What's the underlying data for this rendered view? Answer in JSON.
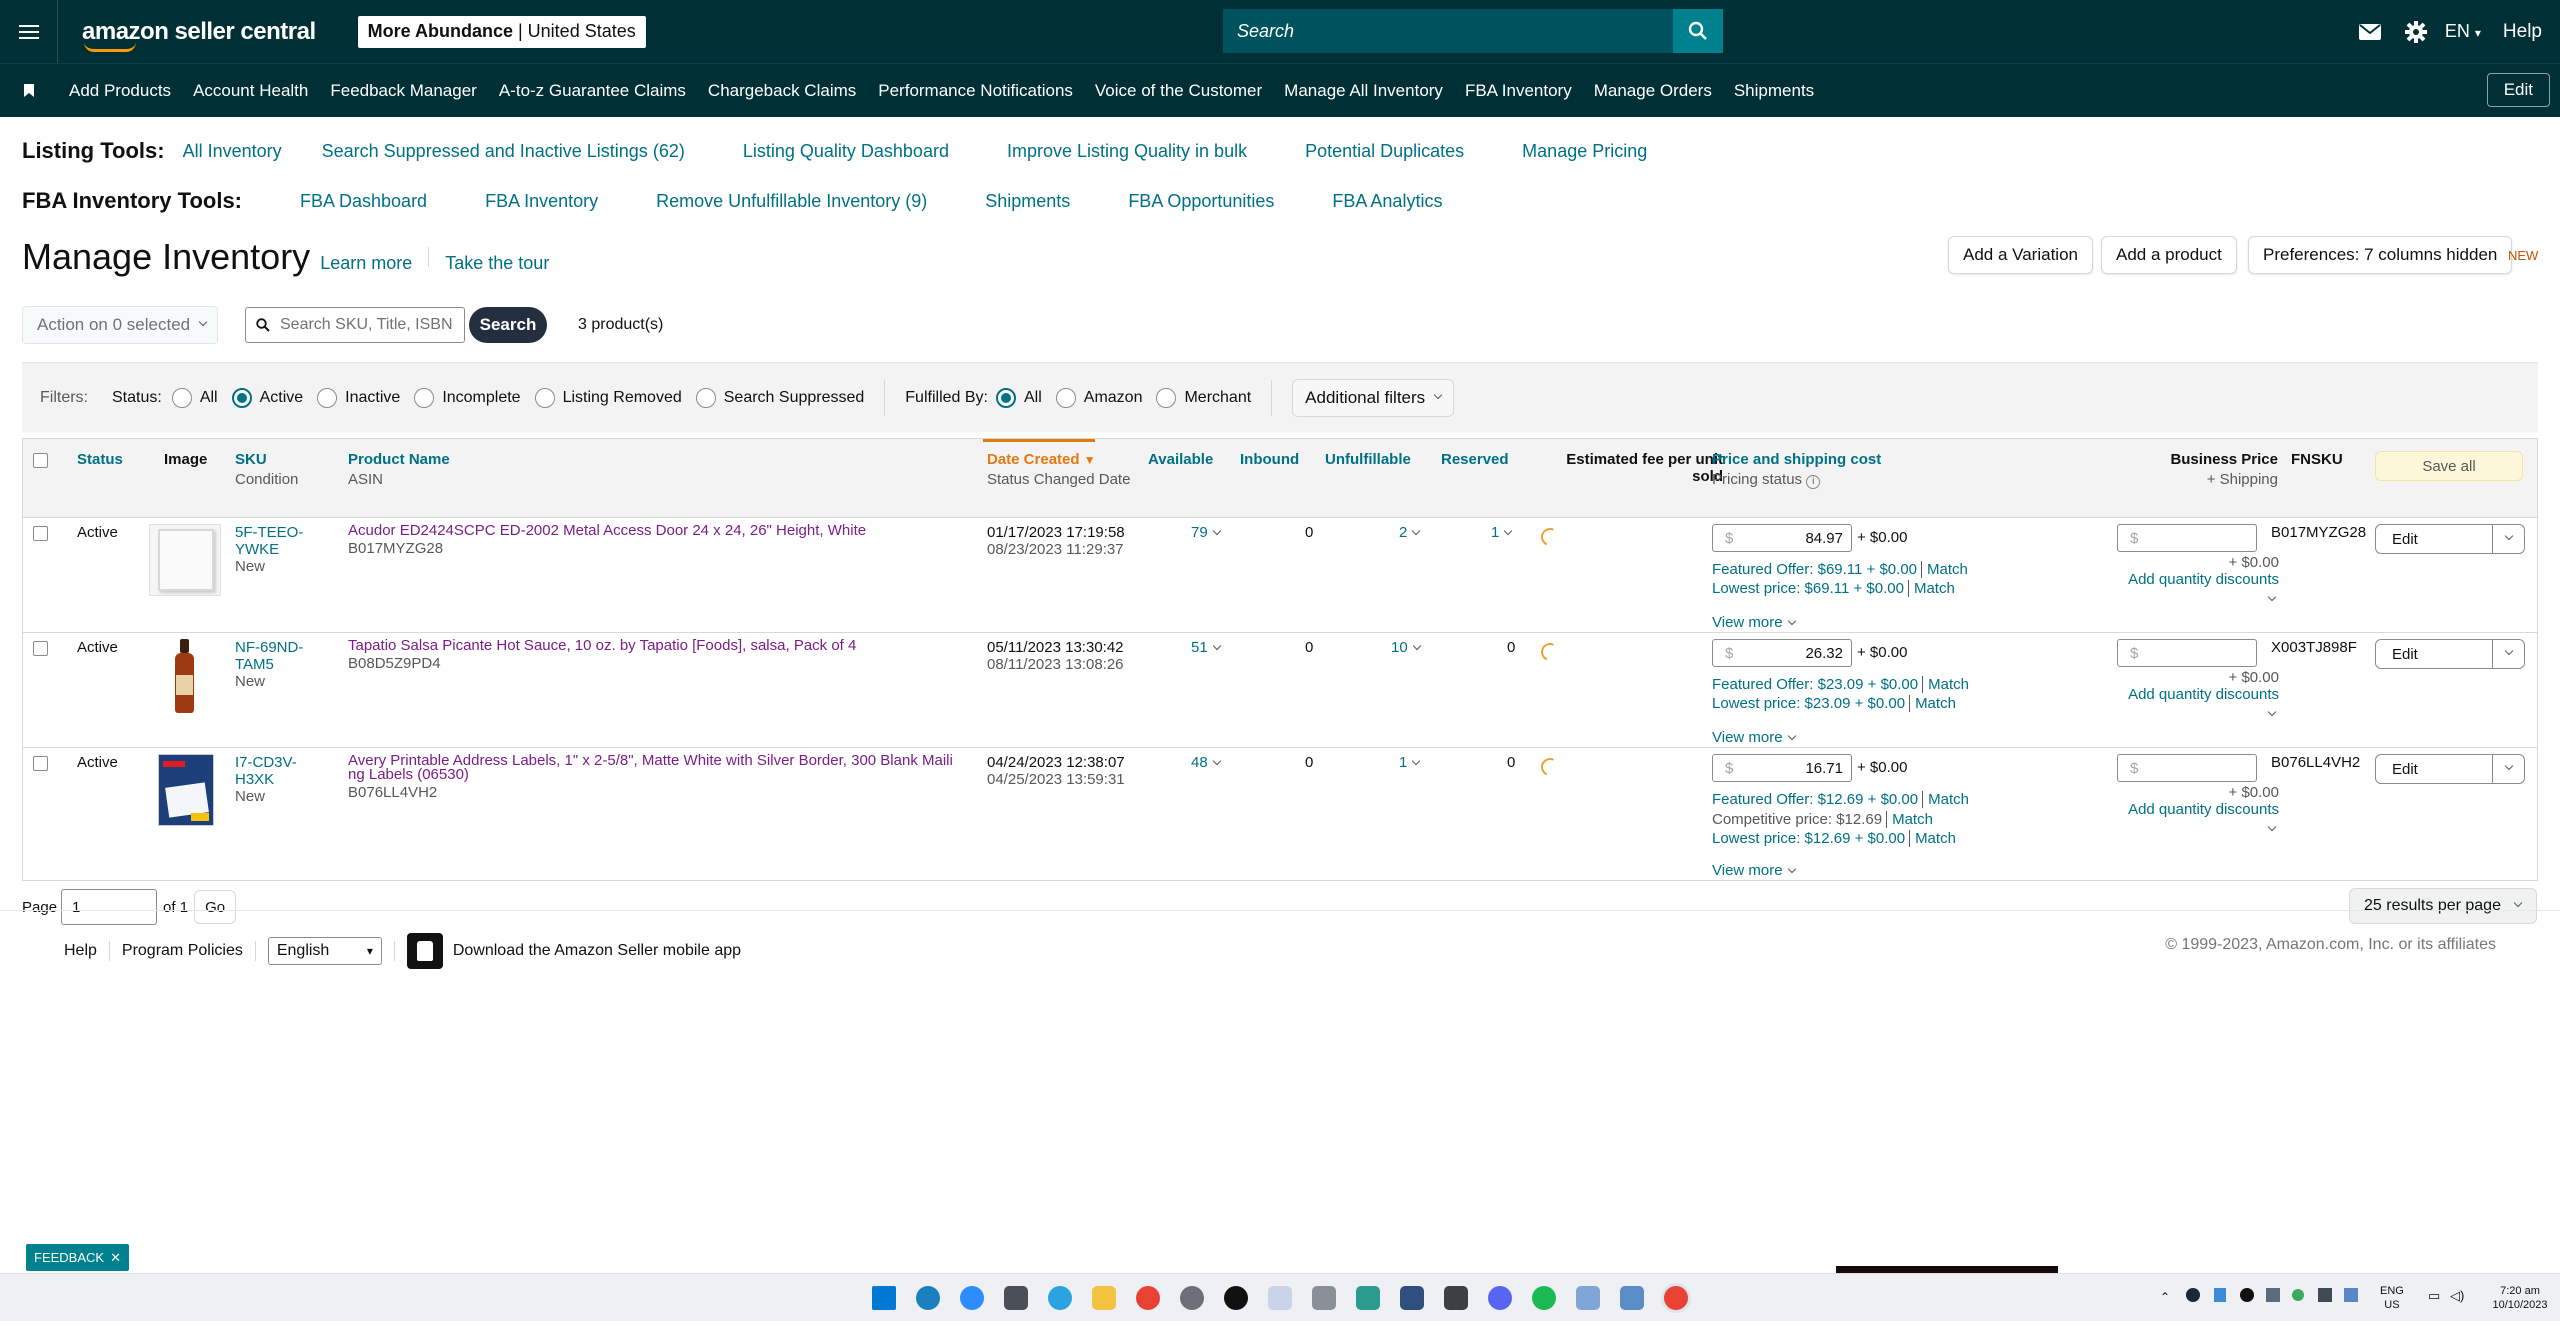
{
  "topbar": {
    "logo_text": "amazon seller central",
    "store_name": "More Abundance",
    "store_region": "United States",
    "search_placeholder": "Search",
    "lang": "EN",
    "help": "Help"
  },
  "nav": {
    "items": [
      "Add Products",
      "Account Health",
      "Feedback Manager",
      "A-to-z Guarantee Claims",
      "Chargeback Claims",
      "Performance Notifications",
      "Voice of the Customer",
      "Manage All Inventory",
      "FBA Inventory",
      "Manage Orders",
      "Shipments"
    ],
    "edit": "Edit"
  },
  "listing_tools": {
    "title": "Listing Tools:",
    "links": [
      "All Inventory",
      "Search Suppressed and Inactive Listings (62)",
      "Listing Quality Dashboard",
      "Improve Listing Quality in bulk",
      "Potential Duplicates",
      "Manage Pricing"
    ]
  },
  "fba_tools": {
    "title": "FBA Inventory Tools:",
    "links": [
      "FBA Dashboard",
      "FBA Inventory",
      "Remove Unfulfillable Inventory (9)",
      "Shipments",
      "FBA Opportunities",
      "FBA Analytics"
    ]
  },
  "page": {
    "title": "Manage Inventory",
    "learn_more": "Learn more",
    "tour": "Take the tour",
    "add_variation": "Add a Variation",
    "add_product": "Add a product",
    "preferences": "Preferences: 7 columns hidden",
    "new_tag": "NEW"
  },
  "search_row": {
    "action": "Action on 0 selected",
    "sku_placeholder": "Search SKU, Title, ISBN",
    "search_btn": "Search",
    "count": "3 product(s)"
  },
  "filters": {
    "label": "Filters:",
    "status_label": "Status:",
    "status_options": [
      "All",
      "Active",
      "Inactive",
      "Incomplete",
      "Listing Removed",
      "Search Suppressed"
    ],
    "status_selected": "Active",
    "fulfilled_label": "Fulfilled By:",
    "fulfilled_options": [
      "All",
      "Amazon",
      "Merchant"
    ],
    "fulfilled_selected": "All",
    "additional": "Additional filters"
  },
  "table": {
    "headers": {
      "status": "Status",
      "image": "Image",
      "sku": "SKU",
      "sku_sub": "Condition",
      "product": "Product Name",
      "product_sub": "ASIN",
      "date": "Date Created",
      "date_sub": "Status Changed Date",
      "available": "Available",
      "inbound": "Inbound",
      "unfulfillable": "Unfulfillable",
      "reserved": "Reserved",
      "fee_1": "Estimated fee per unit",
      "fee_2": "sold",
      "price": "Price and shipping cost",
      "price_sub": "Pricing status",
      "business": "Business Price",
      "business_sub": "+ Shipping",
      "fnsku": "FNSKU",
      "save_all": "Save all"
    },
    "rows": [
      {
        "status": "Active",
        "sku_1": "5F-TEEO-",
        "sku_2": "YWKE",
        "condition": "New",
        "name": "Acudor ED2424SCPC ED-2002 Metal Access Door 24 x 24, 26\" Height, White",
        "name_2": "",
        "asin": "B017MYZG28",
        "created": "01/17/2023 17:19:58",
        "changed": "08/23/2023 11:29:37",
        "available": "79",
        "inbound": "0",
        "unfulfillable": "2",
        "reserved": "1",
        "price": "84.97",
        "shipping": "+ $0.00",
        "featured": "Featured Offer: $69.11 + $0.00",
        "competitive": "",
        "lowest": "Lowest price: $69.11 + $0.00",
        "match": "Match",
        "view_more": "View more",
        "business_ship": "+ $0.00",
        "qty_discounts": "Add quantity discounts",
        "fnsku": "B017MYZG28",
        "edit": "Edit"
      },
      {
        "status": "Active",
        "sku_1": "NF-69ND-",
        "sku_2": "TAM5",
        "condition": "New",
        "name": "Tapatio Salsa Picante Hot Sauce, 10 oz. by Tapatio [Foods], salsa, Pack of 4",
        "name_2": "",
        "asin": "B08D5Z9PD4",
        "created": "05/11/2023 13:30:42",
        "changed": "08/11/2023 13:08:26",
        "available": "51",
        "inbound": "0",
        "unfulfillable": "10",
        "reserved": "0",
        "price": "26.32",
        "shipping": "+ $0.00",
        "featured": "Featured Offer: $23.09 + $0.00",
        "competitive": "",
        "lowest": "Lowest price: $23.09 + $0.00",
        "match": "Match",
        "view_more": "View more",
        "business_ship": "+ $0.00",
        "qty_discounts": "Add quantity discounts",
        "fnsku": "X003TJ898F",
        "edit": "Edit"
      },
      {
        "status": "Active",
        "sku_1": "I7-CD3V-",
        "sku_2": "H3XK",
        "condition": "New",
        "name": "Avery Printable Address Labels, 1\" x 2-5/8\", Matte White with Silver Border, 300 Blank Maili",
        "name_2": "ng Labels (06530)",
        "asin": "B076LL4VH2",
        "created": "04/24/2023 12:38:07",
        "changed": "04/25/2023 13:59:31",
        "available": "48",
        "inbound": "0",
        "unfulfillable": "1",
        "reserved": "0",
        "price": "16.71",
        "shipping": "+ $0.00",
        "featured": "Featured Offer: $12.69 + $0.00",
        "competitive": "Competitive price: $12.69",
        "lowest": "Lowest price: $12.69 + $0.00",
        "match": "Match",
        "view_more": "View more",
        "business_ship": "+ $0.00",
        "qty_discounts": "Add quantity discounts",
        "fnsku": "B076LL4VH2",
        "edit": "Edit"
      }
    ],
    "currency": "$"
  },
  "pager": {
    "page_label": "Page",
    "page_value": "1",
    "of": "of 1",
    "go": "Go",
    "per_page": "25 results per page"
  },
  "footer": {
    "help": "Help",
    "policies": "Program Policies",
    "language": "English",
    "app": "Download the Amazon Seller mobile app",
    "copyright": "© 1999-2023, Amazon.com, Inc. or its affiliates",
    "feedback": "FEEDBACK"
  },
  "taskbar": {
    "lang_1": "ENG",
    "lang_2": "US",
    "time": "7:20 am",
    "date": "10/10/2023"
  },
  "colors": {
    "header_bg": "#002f36",
    "link": "#007185",
    "product_link": "#7c1d8a",
    "sort_orange": "#e47911"
  }
}
